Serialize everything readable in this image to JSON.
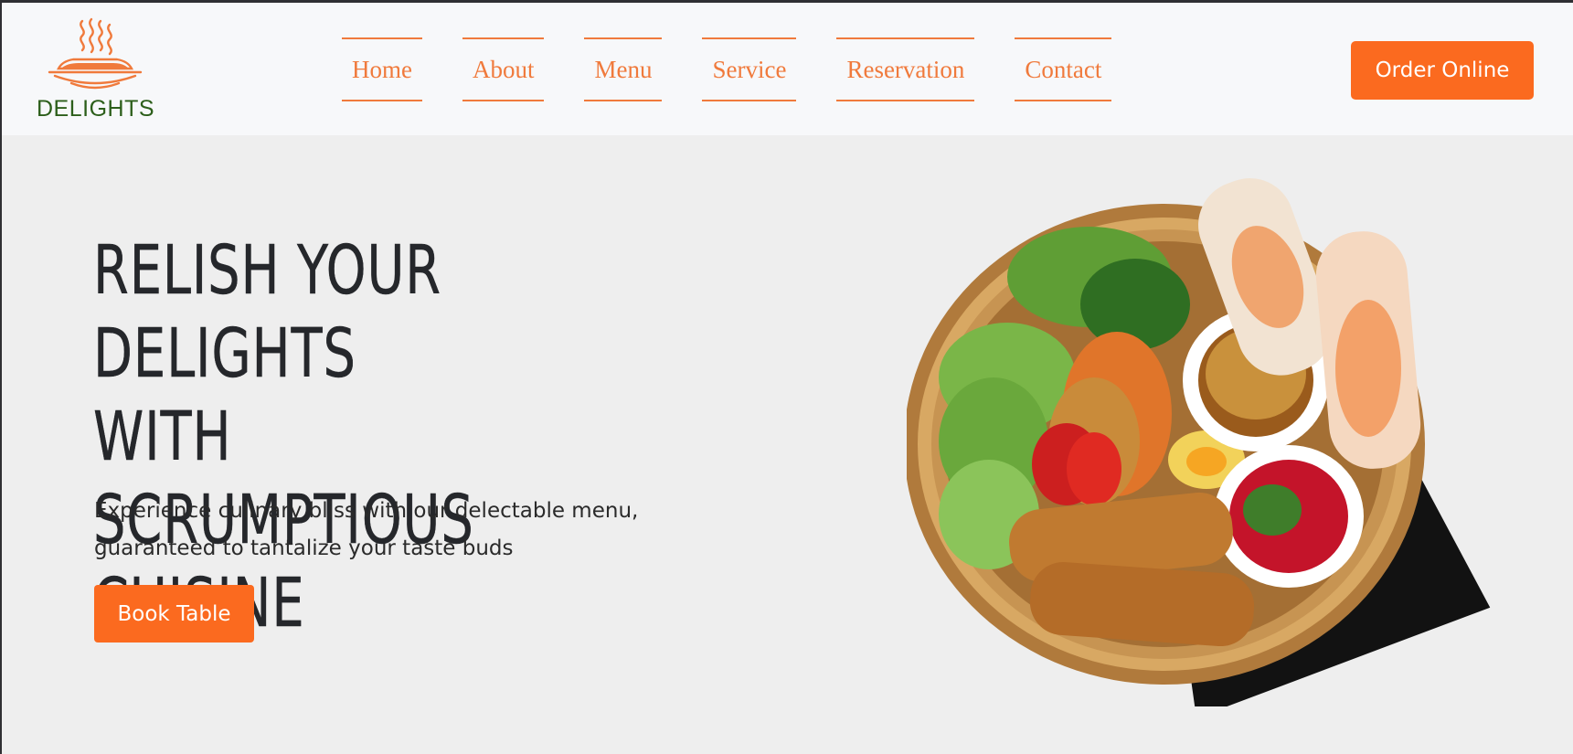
{
  "header": {
    "logo_text": "DELIGHTS",
    "nav": [
      "Home",
      "About",
      "Menu",
      "Service",
      "Reservation",
      "Contact"
    ],
    "order_label": "Order Online"
  },
  "hero": {
    "title_lines": [
      "RELISH YOUR DELIGHTS",
      "WITH SCRUMPTIOUS",
      "CUISINE"
    ],
    "description": "Experience culinary bliss with our delectable menu, guaranteed to tantalize your taste buds",
    "book_label": "Book Table"
  },
  "colors": {
    "accent": "#fb6a1f",
    "nav_text": "#f07a3c",
    "logo_green": "#2c5e1a"
  }
}
